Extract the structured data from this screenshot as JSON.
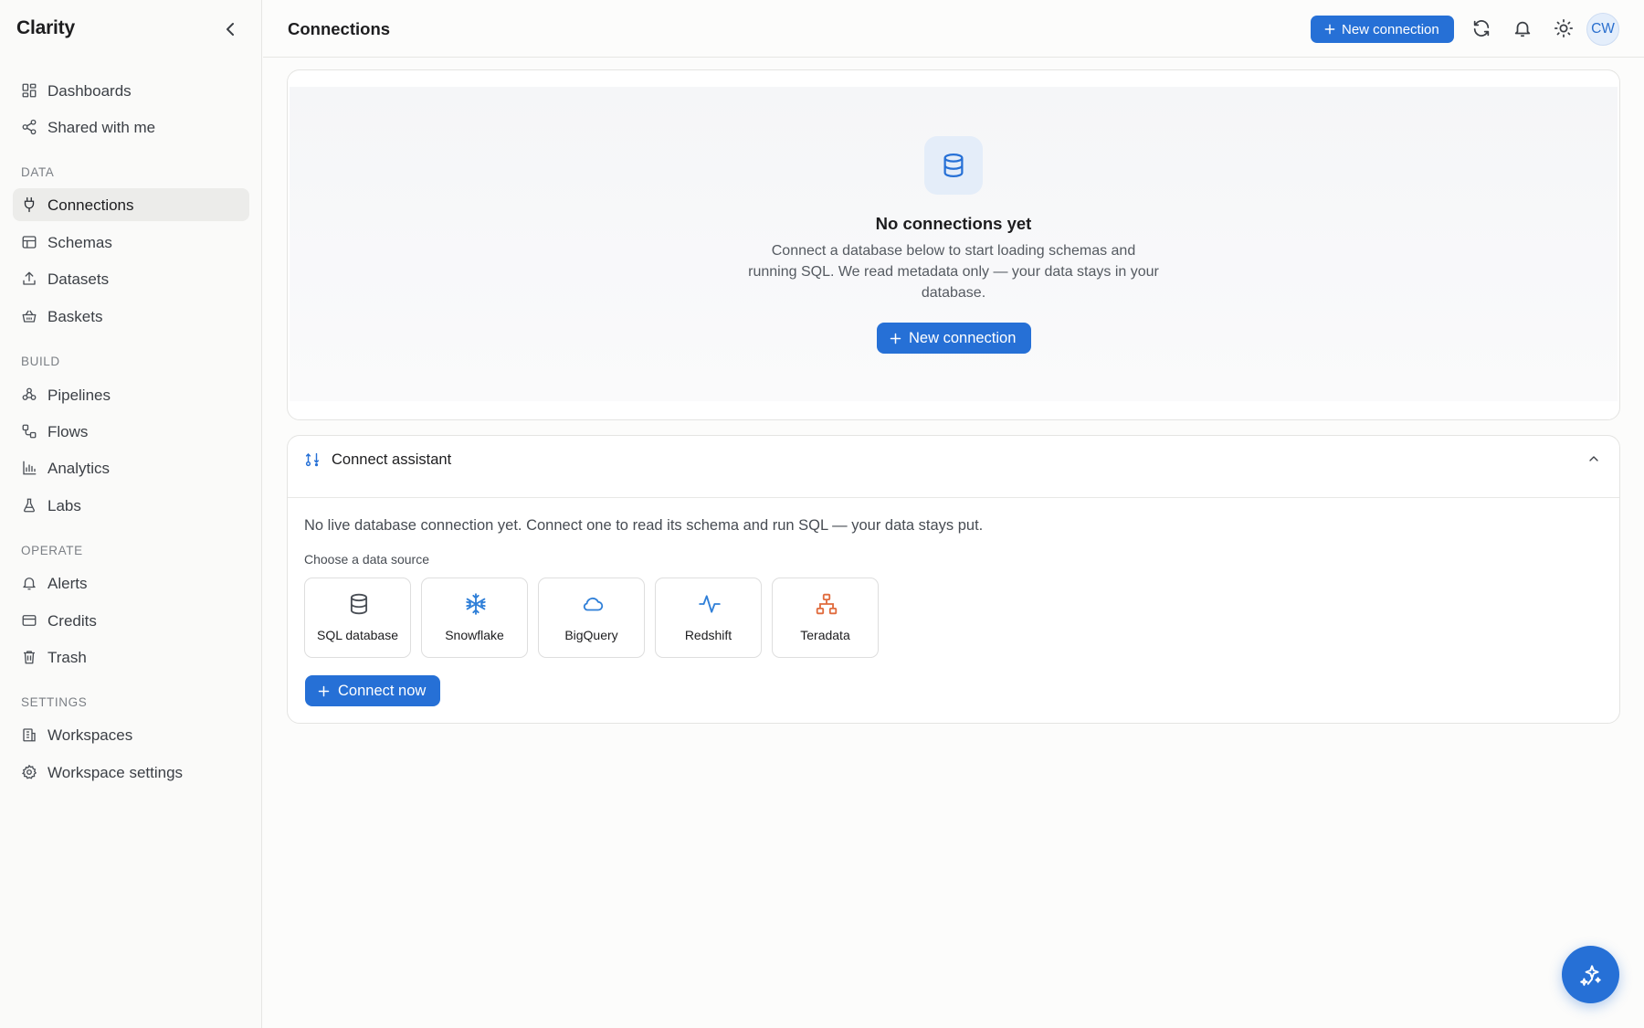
{
  "app": {
    "name": "Clarity"
  },
  "colors": {
    "accent": "#2670d6",
    "sidebar_active": "#ececea",
    "teradata_icon": "#e06b3d"
  },
  "sidebar": {
    "top_items": [
      {
        "label": "Dashboards",
        "icon": "dashboard-icon"
      },
      {
        "label": "Shared with me",
        "icon": "share-icon"
      }
    ],
    "sections": [
      {
        "title": "DATA",
        "items": [
          {
            "label": "Connections",
            "icon": "plug-icon",
            "active": true
          },
          {
            "label": "Schemas",
            "icon": "table-icon"
          },
          {
            "label": "Datasets",
            "icon": "upload-icon"
          },
          {
            "label": "Baskets",
            "icon": "basket-icon"
          }
        ]
      },
      {
        "title": "BUILD",
        "items": [
          {
            "label": "Pipelines",
            "icon": "pipeline-icon"
          },
          {
            "label": "Flows",
            "icon": "flow-icon"
          },
          {
            "label": "Analytics",
            "icon": "bar-chart-icon"
          },
          {
            "label": "Labs",
            "icon": "flask-icon"
          }
        ]
      },
      {
        "title": "OPERATE",
        "items": [
          {
            "label": "Alerts",
            "icon": "bell-icon"
          },
          {
            "label": "Credits",
            "icon": "credit-card-icon"
          },
          {
            "label": "Trash",
            "icon": "trash-icon"
          }
        ]
      },
      {
        "title": "SETTINGS",
        "items": [
          {
            "label": "Workspaces",
            "icon": "building-icon"
          },
          {
            "label": "Workspace settings",
            "icon": "gear-icon"
          }
        ]
      }
    ]
  },
  "header": {
    "title": "Connections",
    "new_connection_label": "New connection",
    "avatar_initials": "CW"
  },
  "empty_state": {
    "title": "No connections yet",
    "description": "Connect a database below to start loading schemas and running SQL. We read metadata only — your data stays in your database.",
    "button_label": "New connection"
  },
  "assistant": {
    "title": "Connect assistant",
    "message": "No live database connection yet. Connect one to read its schema and run SQL — your data stays put.",
    "choose_label": "Choose a data source",
    "sources": [
      {
        "label": "SQL database",
        "icon": "database-icon"
      },
      {
        "label": "Snowflake",
        "icon": "snowflake-icon"
      },
      {
        "label": "BigQuery",
        "icon": "cloud-icon"
      },
      {
        "label": "Redshift",
        "icon": "pulse-icon"
      },
      {
        "label": "Teradata",
        "icon": "hierarchy-icon"
      }
    ],
    "connect_label": "Connect now"
  }
}
